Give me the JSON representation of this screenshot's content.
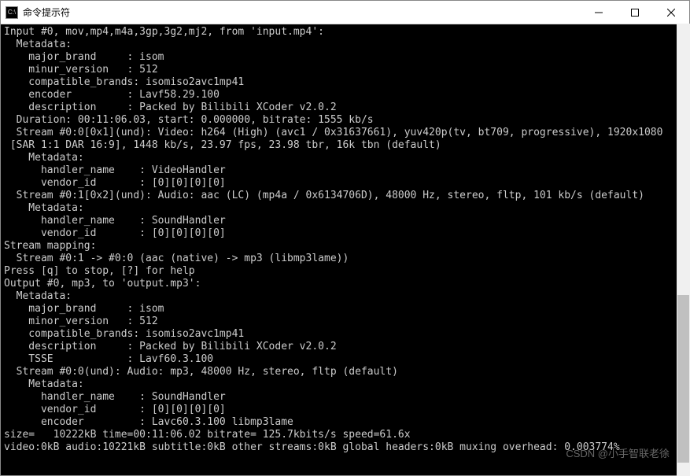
{
  "titlebar": {
    "icon_label": "C:\\",
    "title": "命令提示符"
  },
  "lines": [
    "Input #0, mov,mp4,m4a,3gp,3g2,mj2, from 'input.mp4':",
    "  Metadata:",
    "    major_brand     : isom",
    "    minur_version   : 512",
    "    compatible_brands: isomiso2avc1mp41",
    "    encoder         : Lavf58.29.100",
    "    description     : Packed by Bilibili XCoder v2.0.2",
    "  Duration: 00:11:06.03, start: 0.000000, bitrate: 1555 kb/s",
    "  Stream #0:0[0x1](und): Video: h264 (High) (avc1 / 0x31637661), yuv420p(tv, bt709, progressive), 1920x1080",
    " [SAR 1:1 DAR 16:9], 1448 kb/s, 23.97 fps, 23.98 tbr, 16k tbn (default)",
    "    Metadata:",
    "      handler_name    : VideoHandler",
    "      vendor_id       : [0][0][0][0]",
    "  Stream #0:1[0x2](und): Audio: aac (LC) (mp4a / 0x6134706D), 48000 Hz, stereo, fltp, 101 kb/s (default)",
    "    Metadata:",
    "      handler_name    : SoundHandler",
    "      vendor_id       : [0][0][0][0]",
    "Stream mapping:",
    "  Stream #0:1 -> #0:0 (aac (native) -> mp3 (libmp3lame))",
    "Press [q] to stop, [?] for help",
    "Output #0, mp3, to 'output.mp3':",
    "  Metadata:",
    "    major_brand     : isom",
    "    minor_version   : 512",
    "    compatible_brands: isomiso2avc1mp41",
    "    description     : Packed by Bilibili XCoder v2.0.2",
    "    TSSE            : Lavf60.3.100",
    "  Stream #0:0(und): Audio: mp3, 48000 Hz, stereo, fltp (default)",
    "    Metadata:",
    "      handler_name    : SoundHandler",
    "      vendor_id       : [0][0][0][0]",
    "      encoder         : Lavc60.3.100 libmp3lame",
    "size=   10222kB time=00:11:06.02 bitrate= 125.7kbits/s speed=61.6x",
    "video:0kB audio:10221kB subtitle:0kB other streams:0kB global headers:0kB muxing overhead: 0.003774%"
  ],
  "watermark": "CSDN @小手智联老徐"
}
